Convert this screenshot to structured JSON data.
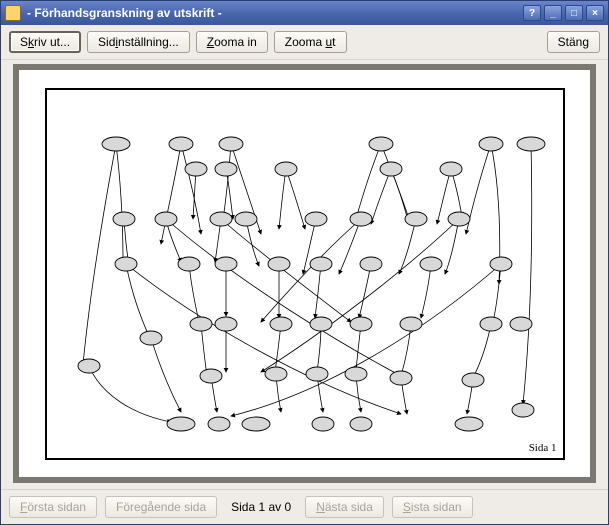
{
  "window": {
    "title": " - Förhandsgranskning av utskrift - "
  },
  "toolbar": {
    "print_pre": "S",
    "print_u": "k",
    "print_post": "riv ut...",
    "pagesetup_pre": "Sid",
    "pagesetup_u": "i",
    "pagesetup_post": "nställning...",
    "zoomin_pre": "",
    "zoomin_u": "Z",
    "zoomin_post": "ooma in",
    "zoomout_pre": "Zooma ",
    "zoomout_u": "u",
    "zoomout_post": "t",
    "close_pre": "Stän",
    "close_u": "g",
    "close_post": ""
  },
  "preview": {
    "page_label": "Sida 1"
  },
  "footer": {
    "first_pre": "",
    "first_u": "F",
    "first_post": "örsta sidan",
    "prev_pre": "Före",
    "prev_u": "g",
    "prev_post": "ående sida",
    "page_indicator": "Sida 1 av 0",
    "next_pre": "",
    "next_u": "N",
    "next_post": "ästa sida",
    "last_pre": "",
    "last_u": "S",
    "last_post": "ista sidan"
  },
  "winctl": {
    "help": "?",
    "min": "_",
    "max": "□",
    "close": "×"
  }
}
